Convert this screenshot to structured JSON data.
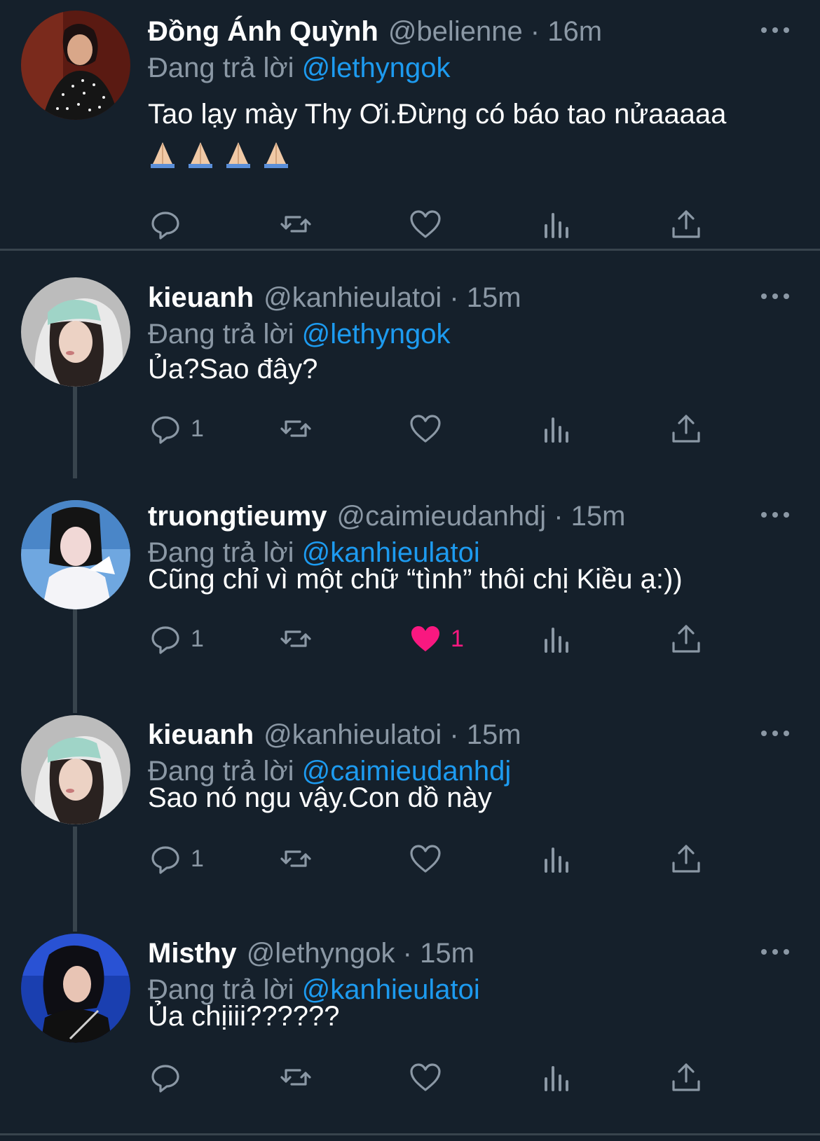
{
  "reply_prefix": "Đang trả lời",
  "colors": {
    "background": "#15202b",
    "link": "#1d9bf0",
    "muted": "#8b98a5",
    "like_active": "#f91880"
  },
  "tweets": [
    {
      "name": "Đồng Ánh Quỳnh",
      "meta": "@belienne · 16m",
      "reply_to": "@lethyngok",
      "text": "Tao lạy mày Thy Ơi.Đừng có báo tao nửaaaaa",
      "emoji": [
        "folded-hands",
        "folded-hands",
        "folded-hands",
        "folded-hands"
      ],
      "reply_count": "",
      "like_count": "",
      "liked": false
    },
    {
      "name": "kieuanh",
      "meta": "@kanhieulatoi · 15m",
      "reply_to": "@lethyngok",
      "text": "Ủa?Sao đây?",
      "reply_count": "1",
      "like_count": "",
      "liked": false
    },
    {
      "name": "truongtieumy",
      "meta": "@caimieudanhdj · 15m",
      "reply_to": "@kanhieulatoi",
      "text": "Cũng chỉ vì một chữ “tình” thôi chị Kiều ạ:))",
      "reply_count": "1",
      "like_count": "1",
      "liked": true
    },
    {
      "name": "kieuanh",
      "meta": "@kanhieulatoi · 15m",
      "reply_to": "@caimieudanhdj",
      "text": "Sao nó ngu vậy.Con dồ này",
      "reply_count": "1",
      "like_count": "",
      "liked": false
    },
    {
      "name": "Misthy",
      "meta": "@lethyngok · 15m",
      "reply_to": "@kanhieulatoi",
      "text": "Ủa chịiii??????",
      "reply_count": "",
      "like_count": "",
      "liked": false
    }
  ]
}
